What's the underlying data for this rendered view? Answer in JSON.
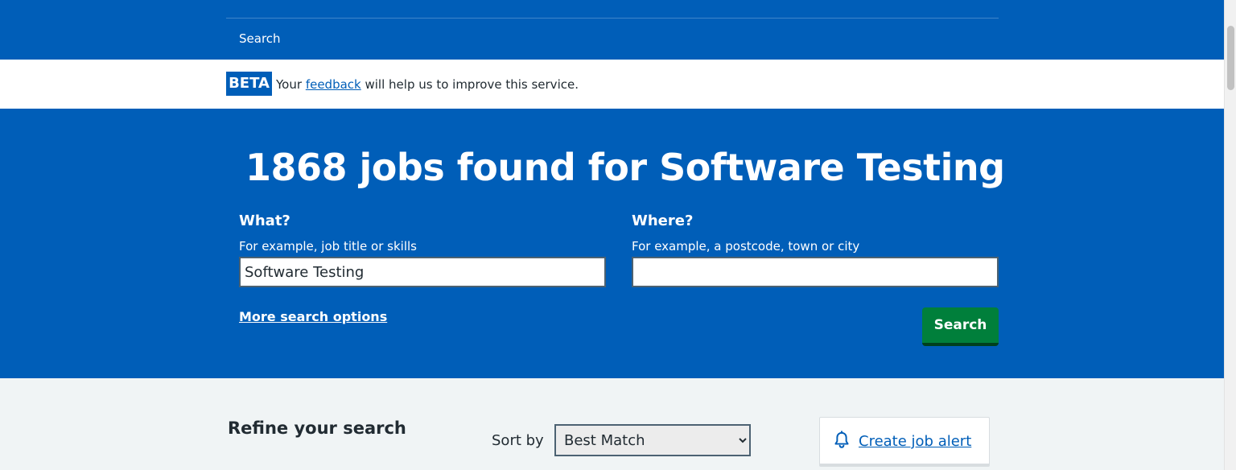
{
  "nav": {
    "search_label": "Search"
  },
  "beta_banner": {
    "tag": "BETA",
    "text_before": "Your",
    "link_text": "feedback",
    "text_after": "will help us to improve this service."
  },
  "hero": {
    "title": "1868 jobs found for Software Testing",
    "what": {
      "label": "What?",
      "hint": "For example, job title or skills",
      "value": "Software Testing"
    },
    "where": {
      "label": "Where?",
      "hint": "For example, a postcode, town or city",
      "value": ""
    },
    "more_options": "More search options",
    "search_button": "Search"
  },
  "results": {
    "refine_heading": "Refine your search",
    "sort_label": "Sort by",
    "sort_selected": "Best Match",
    "alert_link": "Create job alert"
  },
  "colors": {
    "brand_blue": "#005eb8",
    "button_green": "#007f3b",
    "text_dark": "#212b32",
    "page_bg": "#f0f4f5"
  },
  "icons": {
    "alert": "bell-icon"
  }
}
